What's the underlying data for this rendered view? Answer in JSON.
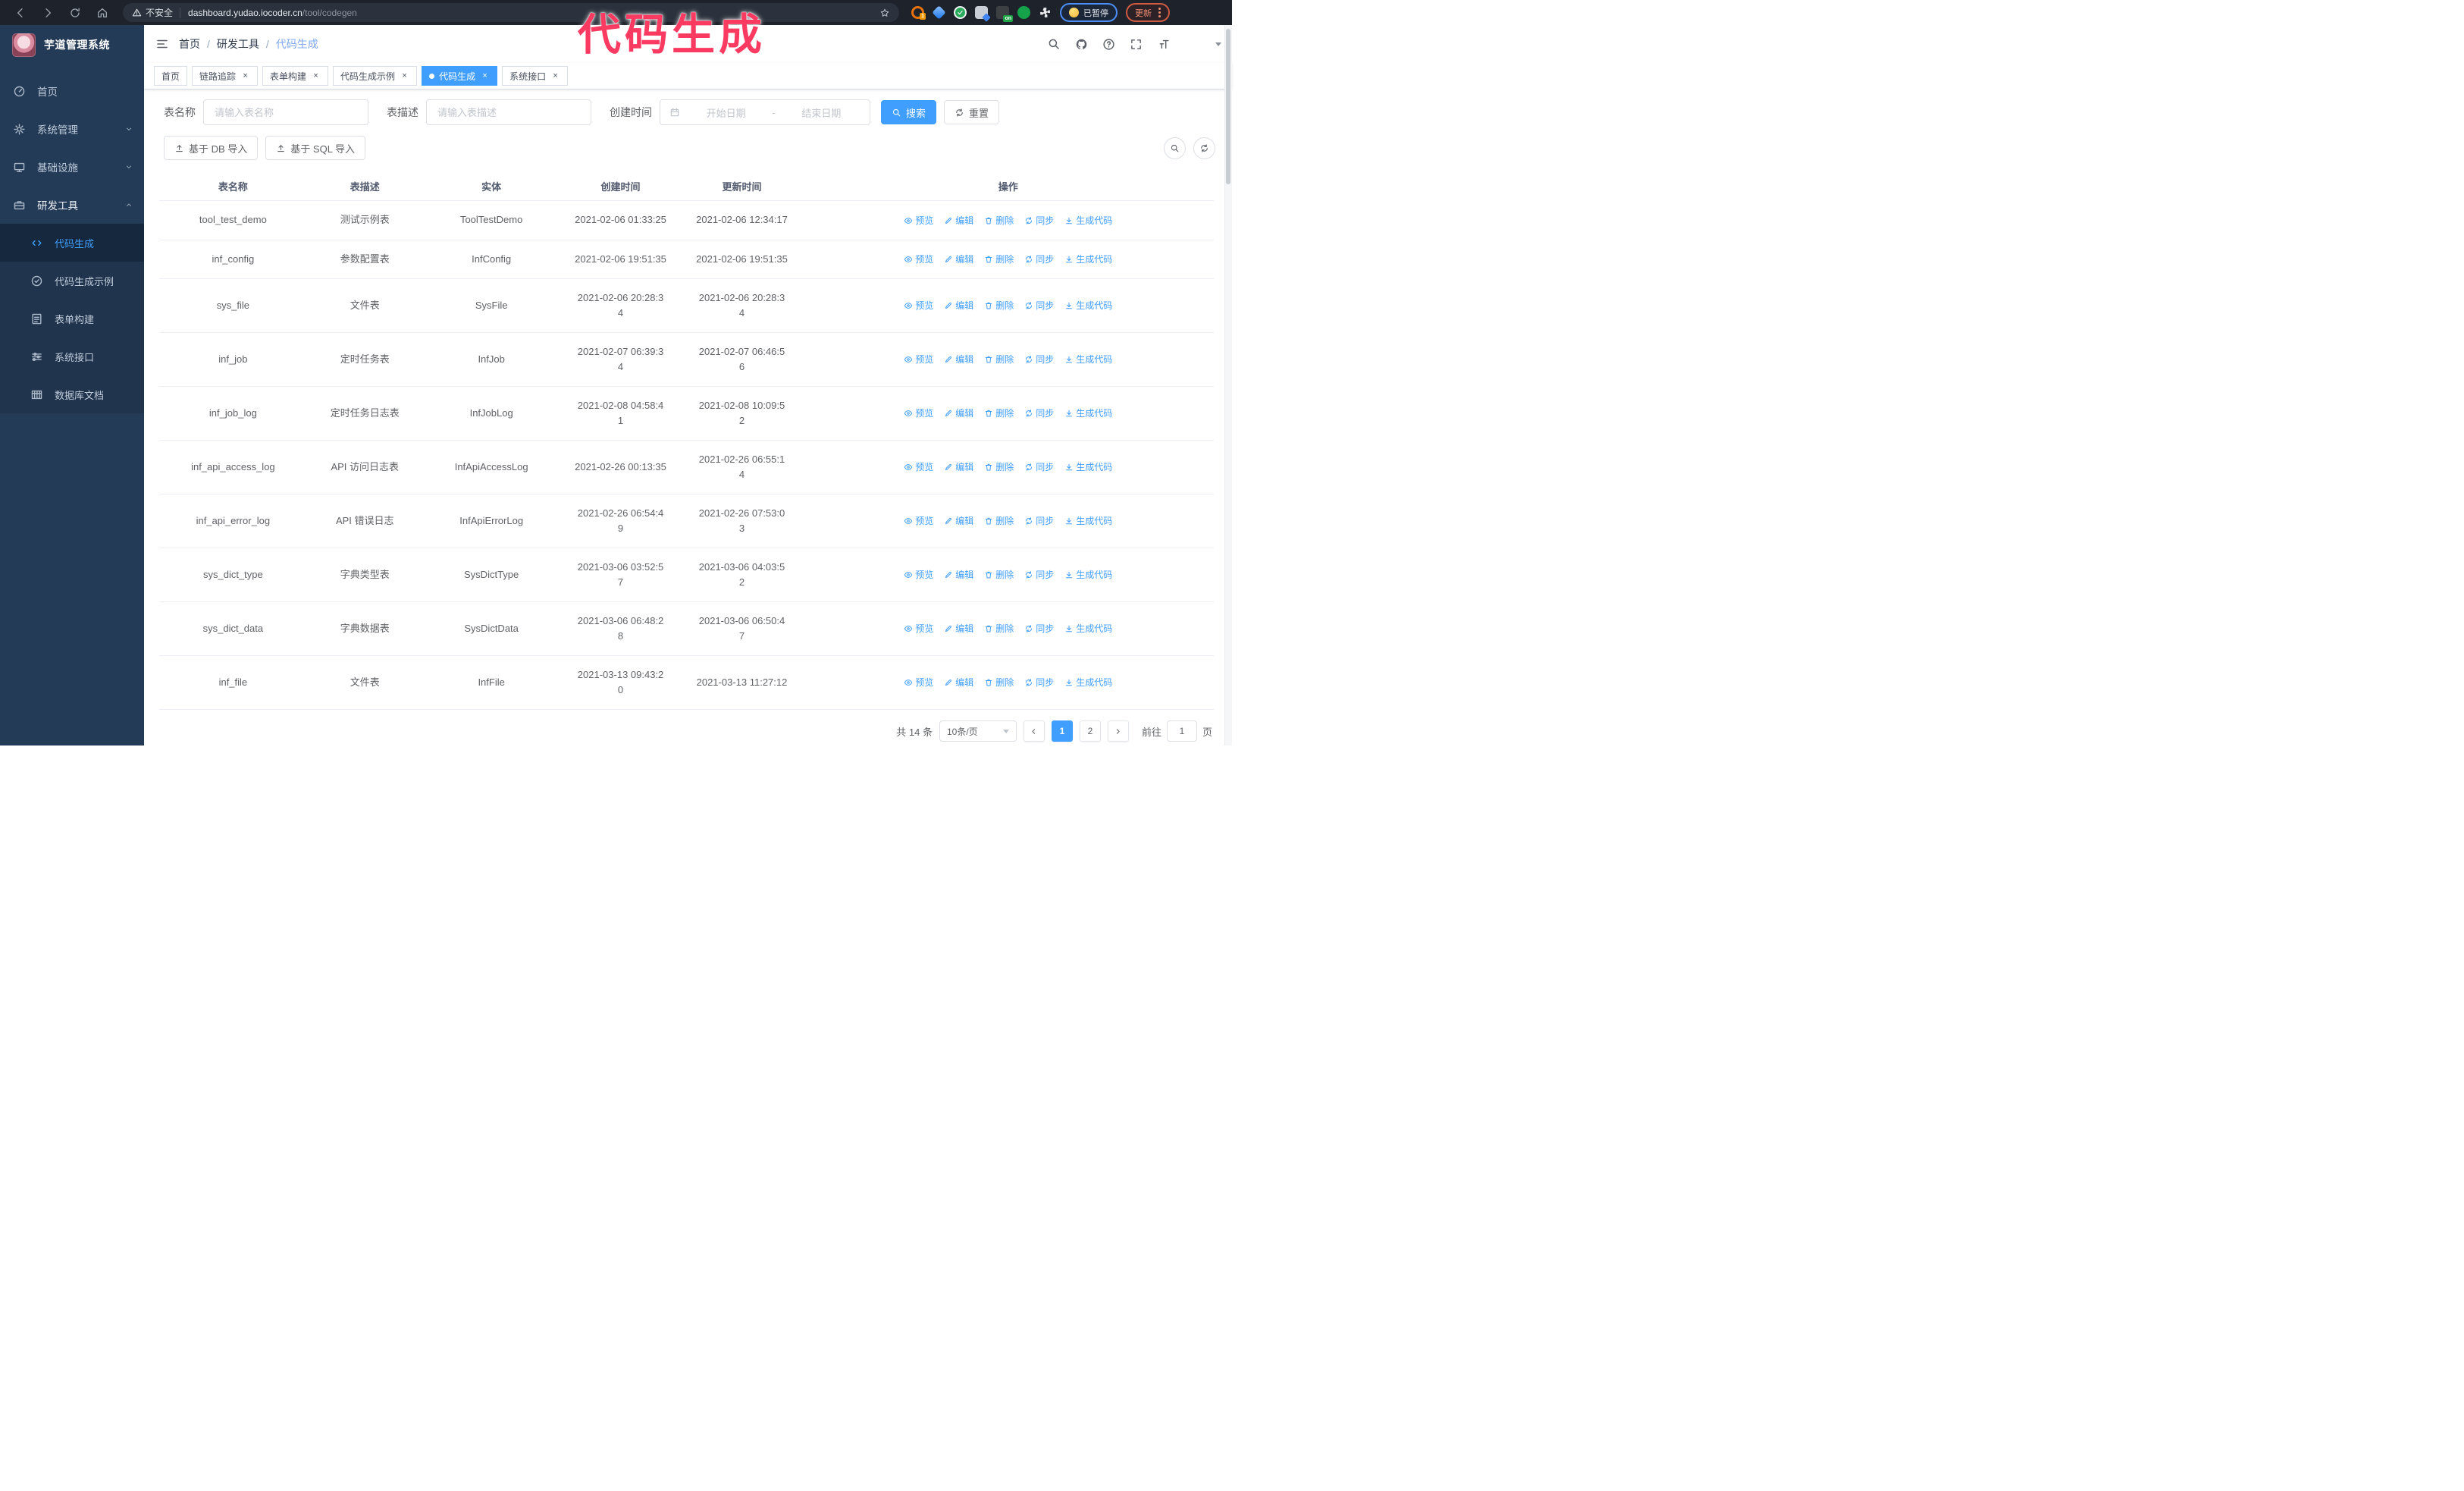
{
  "browser": {
    "security_label": "不安全",
    "url_host": "dashboard.yudao.iocoder.cn",
    "url_path": "/tool/codegen",
    "extension_badge": "1",
    "extension_on_badge": "on",
    "paused_badge": "已暂停",
    "update_button": "更新"
  },
  "annotation": {
    "text": "代码生成",
    "color": "#fa3a60"
  },
  "sidebar": {
    "title": "芋道管理系统",
    "items": [
      {
        "label": "首页"
      },
      {
        "label": "系统管理"
      },
      {
        "label": "基础设施"
      },
      {
        "label": "研发工具"
      }
    ],
    "subitems": [
      {
        "label": "代码生成"
      },
      {
        "label": "代码生成示例"
      },
      {
        "label": "表单构建"
      },
      {
        "label": "系统接口"
      },
      {
        "label": "数据库文档"
      }
    ]
  },
  "header": {
    "breadcrumb": [
      "首页",
      "研发工具",
      "代码生成"
    ]
  },
  "tabs": [
    {
      "label": "首页"
    },
    {
      "label": "链路追踪"
    },
    {
      "label": "表单构建"
    },
    {
      "label": "代码生成示例"
    },
    {
      "label": "代码生成"
    },
    {
      "label": "系统接口"
    }
  ],
  "filters": {
    "name_label": "表名称",
    "name_placeholder": "请输入表名称",
    "desc_label": "表描述",
    "desc_placeholder": "请输入表描述",
    "time_label": "创建时间",
    "start_placeholder": "开始日期",
    "range_separator": "-",
    "end_placeholder": "结束日期",
    "search_button": "搜索",
    "reset_button": "重置"
  },
  "toolbar": {
    "import_db": "基于 DB 导入",
    "import_sql": "基于 SQL 导入"
  },
  "table": {
    "columns": [
      "表名称",
      "表描述",
      "实体",
      "创建时间",
      "更新时间",
      "操作"
    ],
    "actions": [
      "预览",
      "编辑",
      "删除",
      "同步",
      "生成代码"
    ],
    "rows": [
      {
        "name": "tool_test_demo",
        "desc": "测试示例表",
        "entity": "ToolTestDemo",
        "created": "2021-02-06 01:33:25",
        "updated": "2021-02-06 12:34:17"
      },
      {
        "name": "inf_config",
        "desc": "参数配置表",
        "entity": "InfConfig",
        "created": "2021-02-06 19:51:35",
        "updated": "2021-02-06 19:51:35"
      },
      {
        "name": "sys_file",
        "desc": "文件表",
        "entity": "SysFile",
        "created": "2021-02-06 20:28:3\n4",
        "updated": "2021-02-06 20:28:3\n4"
      },
      {
        "name": "inf_job",
        "desc": "定时任务表",
        "entity": "InfJob",
        "created": "2021-02-07 06:39:3\n4",
        "updated": "2021-02-07 06:46:5\n6"
      },
      {
        "name": "inf_job_log",
        "desc": "定时任务日志表",
        "entity": "InfJobLog",
        "created": "2021-02-08 04:58:4\n1",
        "updated": "2021-02-08 10:09:5\n2"
      },
      {
        "name": "inf_api_access_log",
        "desc": "API 访问日志表",
        "entity": "InfApiAccessLog",
        "created": "2021-02-26 00:13:35",
        "updated": "2021-02-26 06:55:1\n4"
      },
      {
        "name": "inf_api_error_log",
        "desc": "API 错误日志",
        "entity": "InfApiErrorLog",
        "created": "2021-02-26 06:54:4\n9",
        "updated": "2021-02-26 07:53:0\n3"
      },
      {
        "name": "sys_dict_type",
        "desc": "字典类型表",
        "entity": "SysDictType",
        "created": "2021-03-06 03:52:5\n7",
        "updated": "2021-03-06 04:03:5\n2"
      },
      {
        "name": "sys_dict_data",
        "desc": "字典数据表",
        "entity": "SysDictData",
        "created": "2021-03-06 06:48:2\n8",
        "updated": "2021-03-06 06:50:4\n7"
      },
      {
        "name": "inf_file",
        "desc": "文件表",
        "entity": "InfFile",
        "created": "2021-03-13 09:43:2\n0",
        "updated": "2021-03-13 11:27:12"
      }
    ]
  },
  "pagination": {
    "total": "共 14 条",
    "page_size": "10条/页",
    "pages": [
      "1",
      "2"
    ],
    "active_page": "1",
    "goto_label": "前往",
    "goto_value": "1",
    "goto_suffix": "页"
  },
  "colors": {
    "accent": "#409eff",
    "sidebar_bg": "#243b58",
    "annotation": "#fa3a60",
    "browser_bar": "#1d222b"
  }
}
